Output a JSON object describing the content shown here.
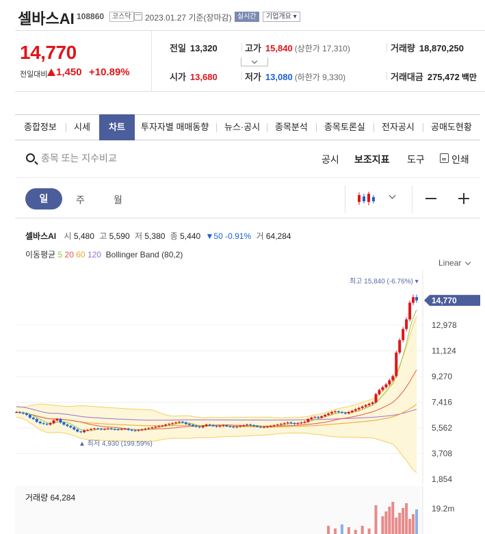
{
  "header": {
    "name": "셀바스AI",
    "code": "108860",
    "market": "코스닥",
    "date": "2023.01.27",
    "basis": "기준(장마감)",
    "realtime": "실시간",
    "company_info": "기업개요 ▾"
  },
  "price": {
    "current": "14,770",
    "diff_label": "전일대비",
    "diff": "1,450",
    "diff_pct": "+10.89%"
  },
  "stats": {
    "prev_label": "전일",
    "prev": "13,320",
    "high_label": "고가",
    "high": "15,840",
    "upper_limit": "(상한가 17,310)",
    "volume_label": "거래량",
    "volume": "18,870,250",
    "open_label": "시가",
    "open": "13,680",
    "low_label": "저가",
    "low": "13,080",
    "lower_limit": "(하한가 9,330)",
    "amount_label": "거래대금",
    "amount": "275,472",
    "amount_unit": "백만"
  },
  "tabs": [
    "종합정보",
    "시세",
    "차트",
    "투자자별 매매동향",
    "뉴스·공시",
    "종목분석",
    "종목토론실",
    "전자공시",
    "공매도현황"
  ],
  "search": {
    "placeholder": "종목 또는 지수비교"
  },
  "tools": {
    "disclosure": "공시",
    "indicator": "보조지표",
    "tool": "도구",
    "print": "인쇄"
  },
  "periods": {
    "day": "일",
    "week": "주",
    "month": "월"
  },
  "ohlc": {
    "name": "셀바스AI",
    "open_k": "시",
    "open": "5,480",
    "high_k": "고",
    "high": "5,590",
    "low_k": "저",
    "low": "5,380",
    "close_k": "종",
    "close": "5,440",
    "change": "▼50 -0.91%",
    "vol_k": "거",
    "vol": "64,284"
  },
  "ma": {
    "label": "이동평균",
    "p5": "5",
    "p20": "20",
    "p60": "60",
    "p120": "120",
    "bollinger": "Bollinger Band",
    "bollinger_params": "(80,2)",
    "color5": "#8cc63f",
    "color20": "#e8534a",
    "color60": "#f0a030",
    "color120": "#9b6fd6"
  },
  "scale": "Linear",
  "chart_data": {
    "type": "candlestick",
    "y_ticks": [
      "12,978",
      "11,124",
      "9,270",
      "7,416",
      "5,562",
      "3,708",
      "1,854"
    ],
    "current_label": "14,770",
    "max_annotation": "최고 15,840 (-6.76%) ▾",
    "min_annotation": "▲ 최저 4,930 (199.59%)",
    "ylim": [
      1854,
      16000
    ],
    "closes": [
      6700,
      6650,
      6600,
      6500,
      6300,
      6200,
      6000,
      5900,
      5850,
      5800,
      5900,
      6100,
      6200,
      5950,
      5800,
      5700,
      5600,
      5450,
      5300,
      5250,
      5380,
      5420,
      5480,
      5520,
      5500,
      5450,
      5480,
      5520,
      5470,
      5450,
      5440,
      5480,
      5500,
      5420,
      5380,
      5360,
      5400,
      5450,
      5500,
      5550,
      5600,
      5650,
      5700,
      5720,
      5800,
      5850,
      5900,
      5950,
      6000,
      5950,
      5850,
      5780,
      5700,
      5650,
      5600,
      5700,
      5800,
      5750,
      5700,
      5650,
      5700,
      5750,
      5680,
      5650,
      5600,
      5650,
      5700,
      5750,
      5800,
      5750,
      5700,
      5650,
      5600,
      5620,
      5650,
      5700,
      5750,
      5800,
      5850,
      5900,
      5950,
      5900,
      5850,
      5900,
      5950,
      6000,
      6200,
      6300,
      6350,
      6300,
      6400,
      6500,
      6600,
      6700,
      6750,
      6700,
      6650,
      6600,
      6700,
      6800,
      6900,
      7000,
      7100,
      7200,
      7300,
      7400,
      8000,
      8300,
      8500,
      8700,
      9000,
      9300,
      11000,
      11900,
      12700,
      13400,
      14600,
      15000,
      14770
    ],
    "volume_label": "거래량 64,284",
    "volume_tick": "19.2m"
  }
}
